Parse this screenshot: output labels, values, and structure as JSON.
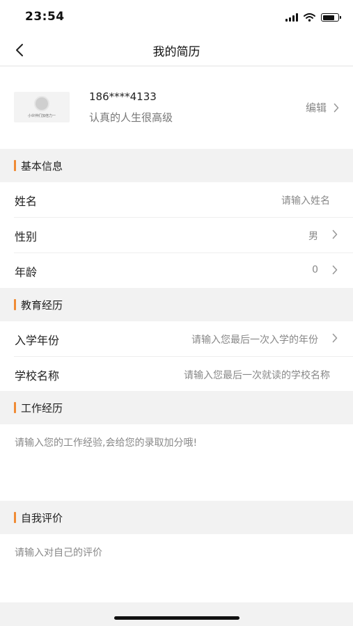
{
  "status_bar": {
    "time": "23:54"
  },
  "nav": {
    "title": "我的简历"
  },
  "profile": {
    "avatar_caption": "小伙伴们加倍力一",
    "phone": "186****4133",
    "motto": "认真的人生很高级",
    "edit_label": "编辑"
  },
  "sections": {
    "basic": {
      "title": "基本信息"
    },
    "education": {
      "title": "教育经历"
    },
    "work": {
      "title": "工作经历"
    },
    "self": {
      "title": "自我评价"
    }
  },
  "basic_rows": [
    {
      "label": "姓名",
      "value": "请输入姓名"
    },
    {
      "label": "性别",
      "value": "男"
    },
    {
      "label": "年龄",
      "value": "0"
    }
  ],
  "education_rows": [
    {
      "label": "入学年份",
      "value": "请输入您最后一次入学的年份"
    },
    {
      "label": "学校名称",
      "value": "请输入您最后一次就读的学校名称"
    }
  ],
  "work": {
    "placeholder": "请输入您的工作经验,会给您的录取加分哦!"
  },
  "self_eval": {
    "placeholder": "请输入对自己的评价"
  },
  "colors": {
    "accent": "#f08b35",
    "background": "#f2f2f2"
  },
  "icons": {
    "back": "chevron-left-icon",
    "chevron": "chevron-right-icon",
    "wifi": "wifi-icon",
    "signal": "signal-icon",
    "battery": "battery-icon"
  }
}
